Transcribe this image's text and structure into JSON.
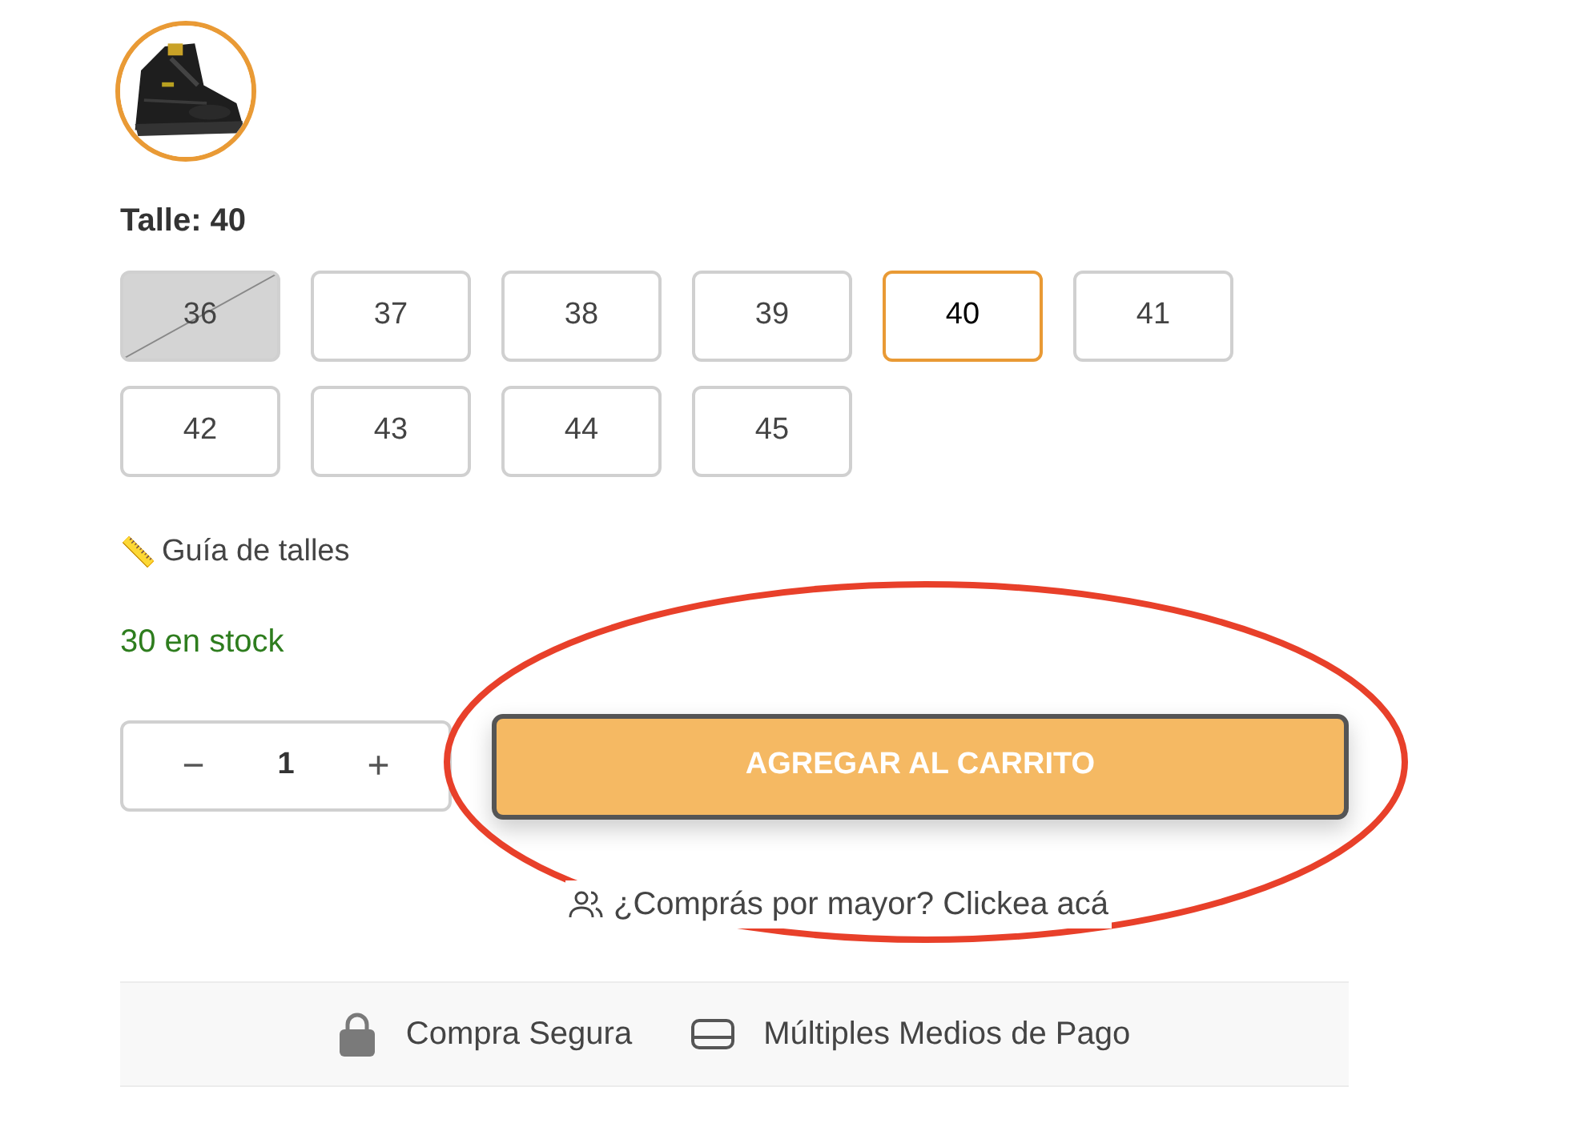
{
  "product_thumbnail": {
    "kind": "picture",
    "selected": true
  },
  "size_label": "Talle: 40",
  "sizes": [
    {
      "label": "36",
      "selected": false,
      "available": false
    },
    {
      "label": "37",
      "selected": false,
      "available": true
    },
    {
      "label": "38",
      "selected": false,
      "available": true
    },
    {
      "label": "39",
      "selected": false,
      "available": true
    },
    {
      "label": "40",
      "selected": true,
      "available": true
    },
    {
      "label": "41",
      "selected": false,
      "available": true
    },
    {
      "label": "42",
      "selected": false,
      "available": true
    },
    {
      "label": "43",
      "selected": false,
      "available": true
    },
    {
      "label": "44",
      "selected": false,
      "available": true
    },
    {
      "label": "45",
      "selected": false,
      "available": true
    }
  ],
  "size_guide": {
    "icon": "📏",
    "label": "Guía de talles"
  },
  "stock": "30 en stock",
  "quantity": {
    "decrease": "−",
    "value": "1",
    "increase": "+"
  },
  "add_to_cart": "AGREGAR AL CARRITO",
  "wholesale_link": "¿Comprás por mayor? Clickea acá",
  "trust_badges": [
    {
      "kind": "lock",
      "label": "Compra Segura"
    },
    {
      "kind": "card",
      "label": "Múltiples Medios de Pago"
    }
  ],
  "annotation": {
    "kind": "ellipse",
    "color": "#e8402a"
  }
}
